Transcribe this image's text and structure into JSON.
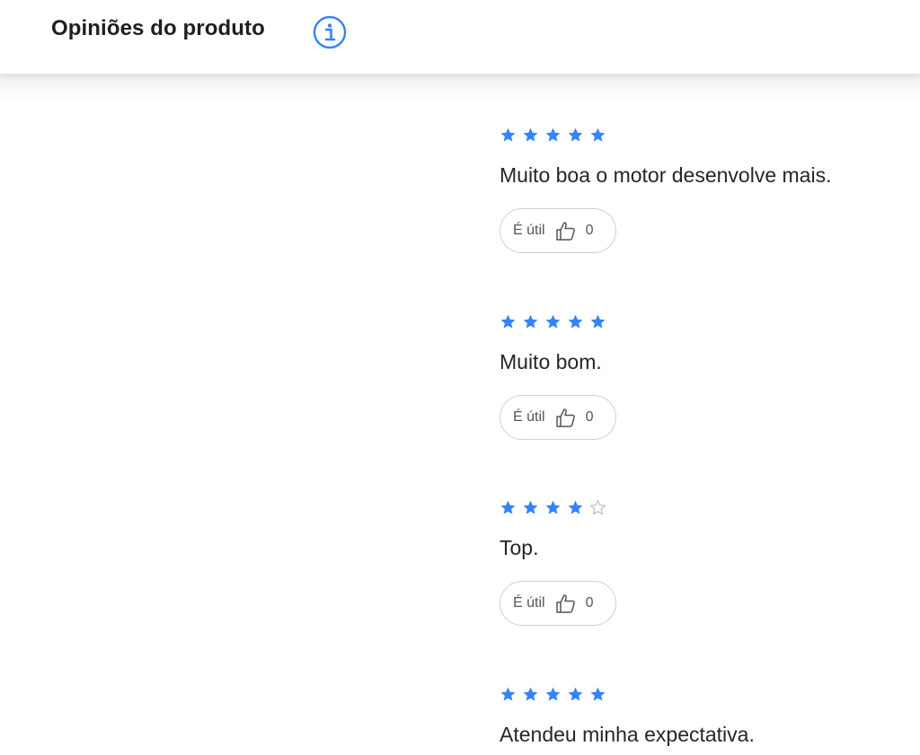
{
  "header": {
    "title": "Opiniões do produto",
    "info_icon": "info-icon"
  },
  "colors": {
    "accent": "#3483fa",
    "empty_star": "#b8b8b8"
  },
  "reviews": [
    {
      "rating": 5,
      "text": "Muito boa o motor desenvolve mais.",
      "useful_label": "É útil",
      "useful_count": "0"
    },
    {
      "rating": 5,
      "text": "Muito bom.",
      "useful_label": "É útil",
      "useful_count": "0"
    },
    {
      "rating": 4,
      "text": "Top.",
      "useful_label": "É útil",
      "useful_count": "0"
    },
    {
      "rating": 5,
      "text": "Atendeu minha expectativa.",
      "useful_label": "É útil",
      "useful_count": "0"
    }
  ]
}
